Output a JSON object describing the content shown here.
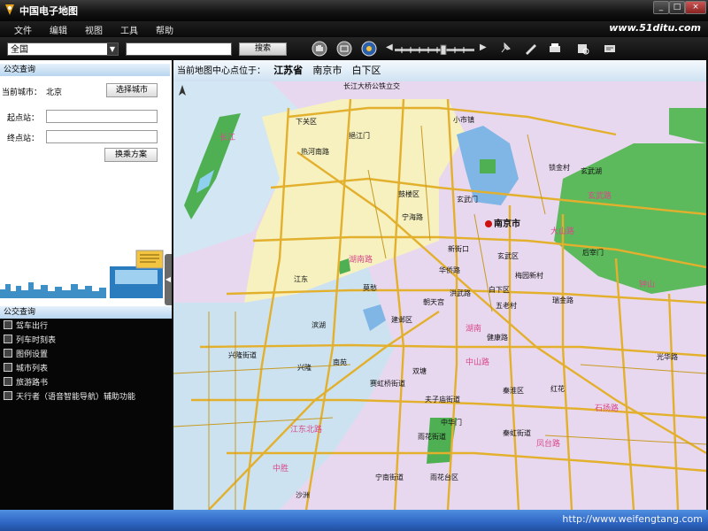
{
  "window": {
    "title": "中国电子地图",
    "buttons": [
      "_",
      "□",
      "×"
    ]
  },
  "menu": {
    "items": [
      "文件",
      "编辑",
      "视图",
      "工具",
      "帮助"
    ],
    "site_url": "www.51ditu.com"
  },
  "toolbar": {
    "city_select_value": "全国",
    "search_query": "",
    "search_label": "搜索",
    "icons": [
      "pan-hand-icon",
      "full-view-icon",
      "location-icon",
      "zoom-out-icon",
      "zoom-in-icon",
      "pin-icon",
      "edit-icon",
      "print-icon",
      "print-preview-icon",
      "settings-icon"
    ]
  },
  "left_panel": {
    "header": "公交查询",
    "current_city_label": "当前城市：",
    "current_city": "北京",
    "select_city_button": "选择城市",
    "start_label": "起点站：",
    "start_value": "",
    "end_label": "终点站：",
    "end_value": "",
    "plan_button": "换乘方案"
  },
  "function_list": {
    "header": "公交查询",
    "items": [
      "驾车出行",
      "列车时刻表",
      "图例设置",
      "城市列表",
      "旅游路书",
      "天行者（语音智能导航）辅助功能"
    ]
  },
  "map": {
    "center_prefix": "当前地图中心点位于：",
    "province": "江苏省",
    "city": "南京市",
    "district": "白下区",
    "labels": {
      "city_name": "南京市",
      "bridge": "长江大桥公铁立交",
      "xiaguan": "下关区",
      "xiaoshiqiao": "小市镇",
      "yijiangmen": "挹江门",
      "rehe_road": "热河南路",
      "gulou": "鼓楼区",
      "ningbo": "宁海路",
      "xuanwu_gate": "玄武门",
      "suojin": "锁金村",
      "xuanwu_lake": "玄武湖",
      "xinjiekou": "新街口",
      "xuanwu_district": "玄武区",
      "houzai": "后宰门",
      "meiyuan": "梅园新村",
      "huaqiao": "华侨路",
      "jiangdong": "江东",
      "mochou": "莫愁",
      "chaotian": "朝天宫",
      "baixia": "白下区",
      "wulaocun": "五老村",
      "ruijin": "瑞金路",
      "hongwu": "洪武路",
      "jianye": "建邺区",
      "binhu": "滨湖",
      "jiankang": "健康路",
      "xinglong_st": "兴隆街道",
      "xinglong": "兴隆",
      "nanyuan": "南苑",
      "shuangtang": "双塘",
      "fuzimiao": "夫子庙街道",
      "guanghua": "光华路",
      "saihong": "赛虹桥街道",
      "zhonghua_gate": "中华门",
      "qinhuai": "秦淮区",
      "honghua": "红花",
      "yuhua_st": "雨花街道",
      "qinhong": "秦虹街道",
      "ningnan": "宁南街道",
      "yuhuatai": "雨花台区",
      "shazhou": "沙洲",
      "changjiang": "长江",
      "zhongsheng": "中胜",
      "hunan_road": "湖南路",
      "hunan": "湖南",
      "shiyang": "石扬路",
      "dashan": "大山路",
      "qinhuai_road": "江东北路",
      "fengtai": "凤台路",
      "xuanwu_road": "玄武路",
      "zhongshan": "中山路",
      "xiaoling": "钟山"
    }
  },
  "taskbar": {
    "watermark": "http://www.weifengtang.com"
  },
  "colors": {
    "north_district": "#f7f2c0",
    "west_district": "#cde3f0",
    "central_district": "#e8d6ef",
    "water": "#7fb6e6",
    "green": "#59b95b",
    "road": "#e3b02e",
    "title_bg": "#0a0a0a",
    "taskbar": "#2f66c4"
  }
}
